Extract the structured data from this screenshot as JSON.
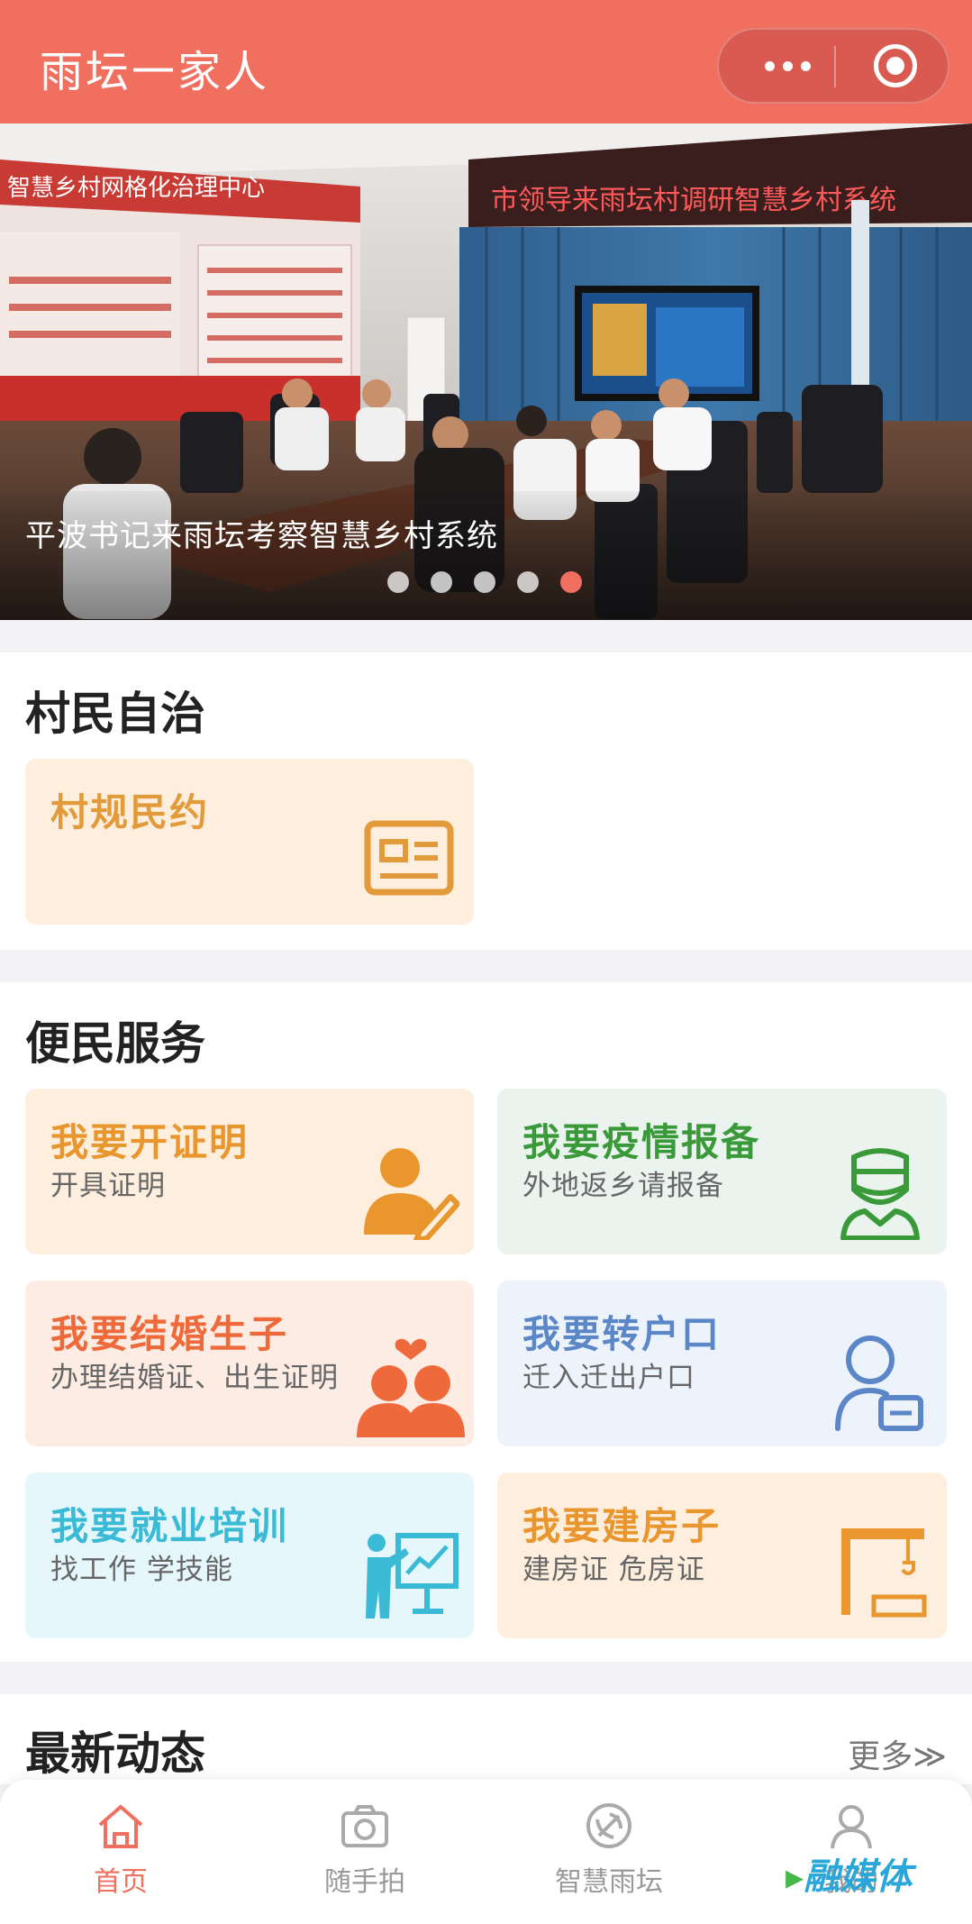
{
  "header": {
    "title": "雨坛一家人"
  },
  "banner": {
    "caption": "平波书记来雨坛考察智慧乡村系统",
    "wall_sign_top": "智慧乡村网格化治理中心",
    "red_led": "市领导来雨坛村调研智慧乡村系统",
    "dots_count": 5,
    "active_dot": 5
  },
  "villager_autonomy": {
    "title": "村民自治",
    "items": [
      {
        "title": "村规民约",
        "icon": "id-card-icon",
        "color": "#e29b3a",
        "bg": "#fdeedd"
      }
    ]
  },
  "convenience_services": {
    "title": "便民服务",
    "items": [
      {
        "title": "我要开证明",
        "subtitle": "开具证明",
        "icon": "person-pen-icon",
        "color": "#e8962d",
        "bg": "#fdeedd"
      },
      {
        "title": "我要疫情报备",
        "subtitle": "外地返乡请报备",
        "icon": "doctor-icon",
        "color": "#3a9a3a",
        "bg": "#eaf3ee"
      },
      {
        "title": "我要结婚生子",
        "subtitle": "办理结婚证、出生证明",
        "icon": "couple-heart-icon",
        "color": "#ef6a3a",
        "bg": "#fdece4"
      },
      {
        "title": "我要转户口",
        "subtitle": "迁入迁出户口",
        "icon": "person-card-icon",
        "color": "#5b86c7",
        "bg": "#edf3fb"
      },
      {
        "title": "我要就业培训",
        "subtitle": "找工作 学技能",
        "icon": "presentation-icon",
        "color": "#3bbad6",
        "bg": "#e6f7fb"
      },
      {
        "title": "我要建房子",
        "subtitle": "建房证 危房证",
        "icon": "crane-icon",
        "color": "#e8962d",
        "bg": "#fdeedd"
      }
    ]
  },
  "latest_news": {
    "title": "最新动态",
    "more_label": "更多≫"
  },
  "tabbar": {
    "items": [
      {
        "label": "首页",
        "icon": "home-icon",
        "active": true
      },
      {
        "label": "随手拍",
        "icon": "camera-icon",
        "active": false
      },
      {
        "label": "智慧雨坛",
        "icon": "party-emblem-icon",
        "active": false
      },
      {
        "label": "我的",
        "icon": "user-icon",
        "active": false
      }
    ]
  },
  "watermark": {
    "text": "融媒体"
  },
  "colors": {
    "accent": "#f06f5f",
    "capsule": "#d85a50"
  }
}
